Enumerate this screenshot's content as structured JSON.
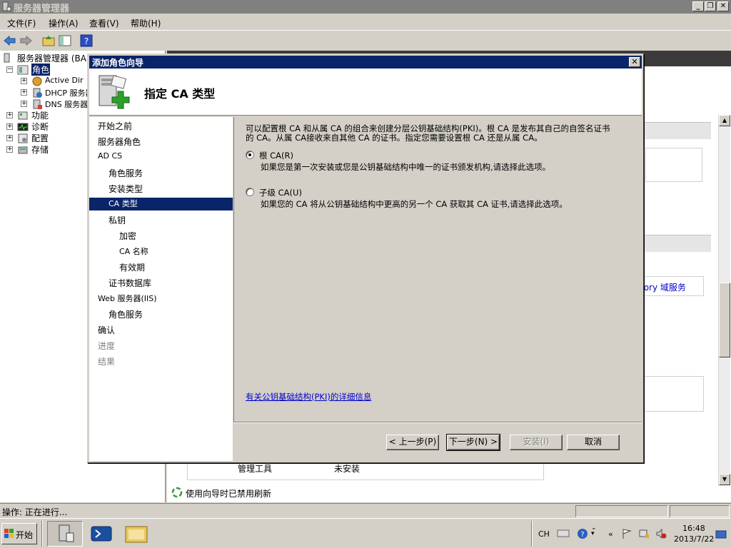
{
  "window": {
    "title": "服务器管理器",
    "min": "_",
    "max": "❐",
    "close": "✕"
  },
  "menu": [
    "文件(F)",
    "操作(A)",
    "查看(V)",
    "帮助(H)"
  ],
  "tree": {
    "root": "服务器管理器 (BA",
    "roles": "角色",
    "role_children": [
      "Active Dir",
      "DHCP 服务器",
      "DNS 服务器"
    ],
    "others": [
      "功能",
      "诊断",
      "配置",
      "存储"
    ]
  },
  "content": {
    "right_link": "tory 域服务",
    "table_row": {
      "name": "管理工具",
      "status": "未安装"
    },
    "refresh_notice": "使用向导时已禁用刷新"
  },
  "status": {
    "text": "操作:  正在进行..."
  },
  "dialog": {
    "title": "添加角色向导",
    "heading": "指定 CA 类型",
    "nav": [
      {
        "label": "开始之前",
        "indent": 0,
        "state": "normal"
      },
      {
        "label": "服务器角色",
        "indent": 0,
        "state": "normal"
      },
      {
        "label": "AD CS",
        "indent": 0,
        "state": "normal"
      },
      {
        "label": "角色服务",
        "indent": 1,
        "state": "normal"
      },
      {
        "label": "安装类型",
        "indent": 1,
        "state": "normal"
      },
      {
        "label": "CA 类型",
        "indent": 1,
        "state": "selected"
      },
      {
        "label": "私钥",
        "indent": 1,
        "state": "normal"
      },
      {
        "label": "加密",
        "indent": 2,
        "state": "normal"
      },
      {
        "label": "CA 名称",
        "indent": 2,
        "state": "normal"
      },
      {
        "label": "有效期",
        "indent": 2,
        "state": "normal"
      },
      {
        "label": "证书数据库",
        "indent": 1,
        "state": "normal"
      },
      {
        "label": "Web 服务器(IIS)",
        "indent": 0,
        "state": "normal"
      },
      {
        "label": "角色服务",
        "indent": 1,
        "state": "normal"
      },
      {
        "label": "确认",
        "indent": 0,
        "state": "normal"
      },
      {
        "label": "进度",
        "indent": 0,
        "state": "disabled"
      },
      {
        "label": "结果",
        "indent": 0,
        "state": "disabled"
      }
    ],
    "intro_line1": "可以配置根 CA 和从属 CA 的组合来创建分层公钥基础结构(PKI)。根 CA 是发布其自己的自签名证书",
    "intro_line2": "的 CA。从属 CA接收来自其他 CA 的证书。指定您需要设置根 CA 还是从属 CA。",
    "option_root": {
      "label": "根 CA(R)",
      "desc": "如果您是第一次安装或您是公钥基础结构中唯一的证书颁发机构,请选择此选项。",
      "selected": true
    },
    "option_sub": {
      "label": "子级 CA(U)",
      "desc": "如果您的 CA 将从公钥基础结构中更高的另一个 CA 获取其 CA 证书,请选择此选项。",
      "selected": false
    },
    "more_info_link": "有关公钥基础结构(PKI)的详细信息",
    "buttons": {
      "back": "< 上一步(P)",
      "next": "下一步(N) >",
      "install": "安装(I)",
      "cancel": "取消"
    }
  },
  "taskbar": {
    "start": "开始",
    "lang": "CH",
    "time": "16:48",
    "date": "2013/7/22"
  },
  "colors": {
    "dialog_title": "#0a246a",
    "selected_nav": "#0a246a",
    "link": "#0000cc"
  }
}
